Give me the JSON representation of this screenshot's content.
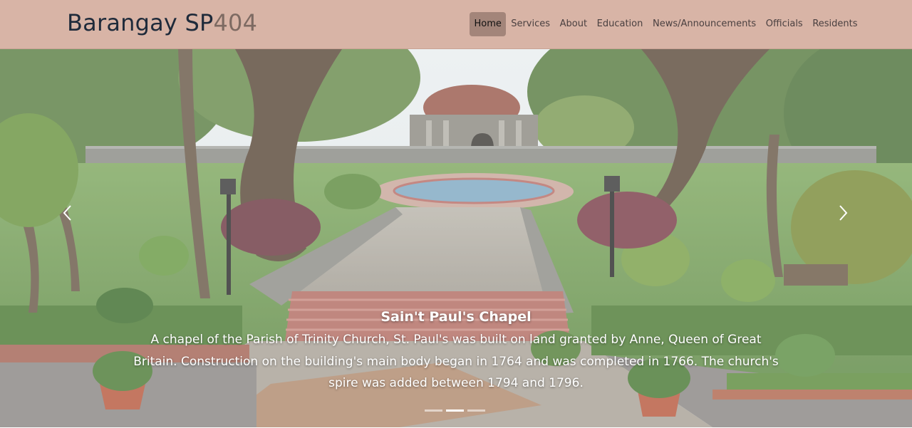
{
  "brand": {
    "main": "Barangay SP",
    "accent": "404"
  },
  "nav": {
    "items": [
      {
        "label": "Home",
        "active": true
      },
      {
        "label": "Services"
      },
      {
        "label": "About"
      },
      {
        "label": "Education"
      },
      {
        "label": "News/Announcements"
      },
      {
        "label": "Officials"
      },
      {
        "label": "Residents"
      }
    ]
  },
  "carousel": {
    "active_slide": 2,
    "slide_count": 3,
    "prev_icon": "chevron-left-icon",
    "next_icon": "chevron-right-icon",
    "caption": {
      "title": "Sain't Paul's Chapel",
      "text": "A chapel of the Parish of Trinity Church, St. Paul's was built on land granted by Anne, Queen of Great Britain. Construction on the building's main body began in 1764 and was completed in 1766. The church's spire was added between 1794 and 1796."
    }
  },
  "colors": {
    "navbar_bg": "#d8b4a6",
    "brand_text": "#1e2a3a",
    "brand_accent": "#7d6a62",
    "active_nav_bg": "#a3857a"
  }
}
